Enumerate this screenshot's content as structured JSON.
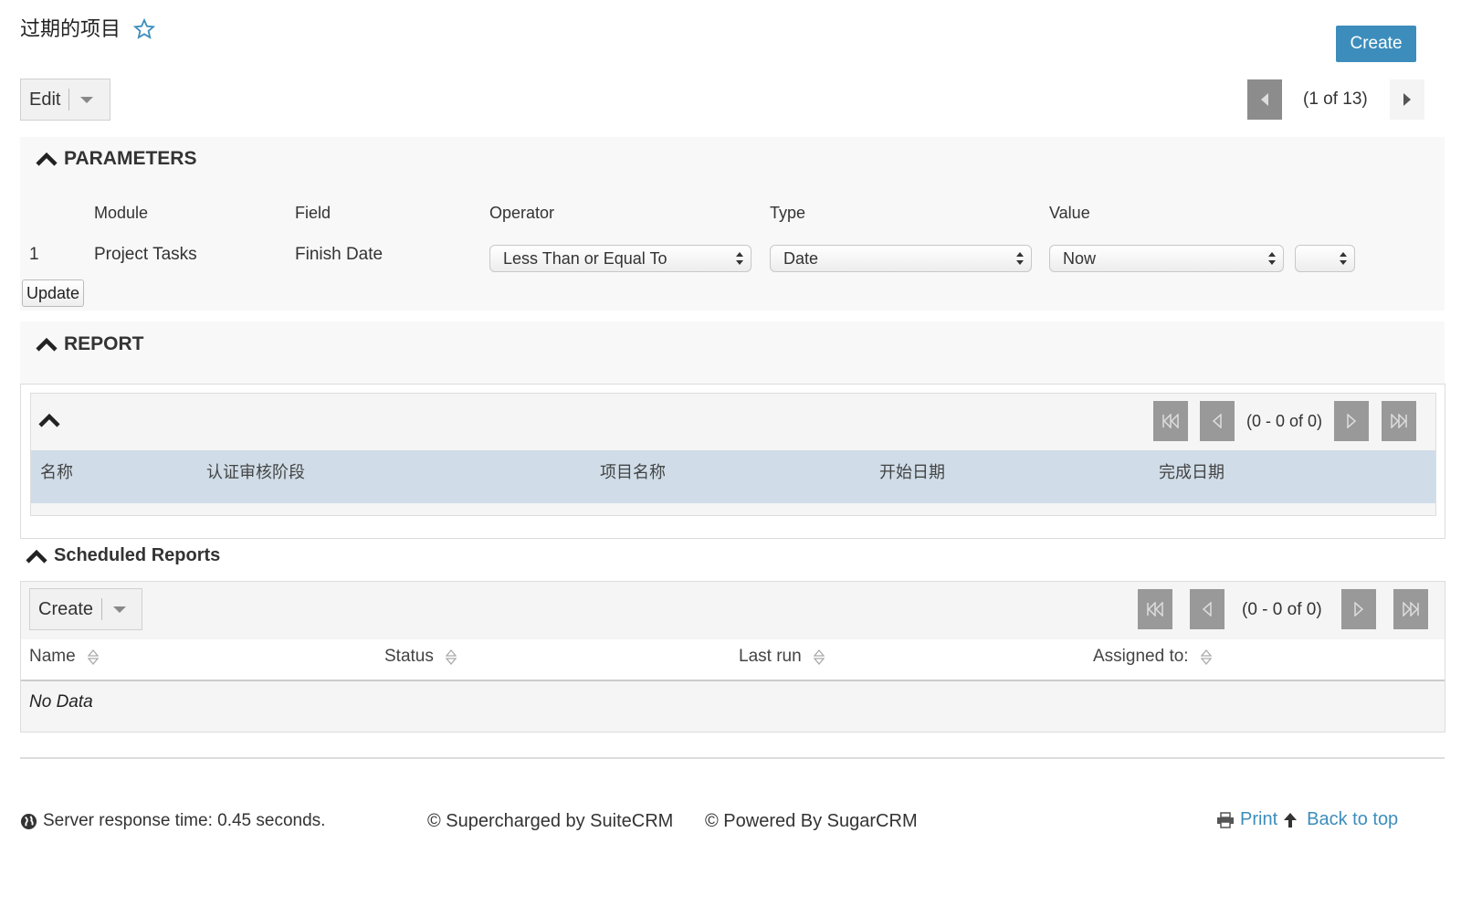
{
  "header": {
    "title": "过期的项目",
    "create_label": "Create"
  },
  "toolbar": {
    "edit_label": "Edit",
    "pagination": "(1 of 13)"
  },
  "parameters": {
    "heading": "PARAMETERS",
    "columns": [
      "Module",
      "Field",
      "Operator",
      "Type",
      "Value"
    ],
    "row": {
      "index": "1",
      "module": "Project Tasks",
      "field": "Finish Date",
      "operator": "Less Than or Equal To",
      "type": "Date",
      "value": "Now",
      "extra": ""
    },
    "update_label": "Update"
  },
  "report": {
    "heading": "REPORT",
    "pagination": "(0 - 0 of 0)",
    "columns": [
      "名称",
      "认证审核阶段",
      "项目名称",
      "开始日期",
      "完成日期"
    ]
  },
  "scheduled": {
    "heading": "Scheduled Reports",
    "create_label": "Create",
    "pagination": "(0 - 0 of 0)",
    "columns": [
      "Name",
      "Status",
      "Last run",
      "Assigned to:"
    ],
    "empty_text": "No Data"
  },
  "footer": {
    "response_time": "Server response time: 0.45 seconds.",
    "suitecrm": "© Supercharged by SuiteCRM",
    "sugarcrm": "© Powered By SugarCRM",
    "print": "Print",
    "back_to_top": "Back to top"
  },
  "colors": {
    "accent": "#3c8dbc",
    "table_header": "#d0dde8",
    "pager_button": "#999999"
  }
}
